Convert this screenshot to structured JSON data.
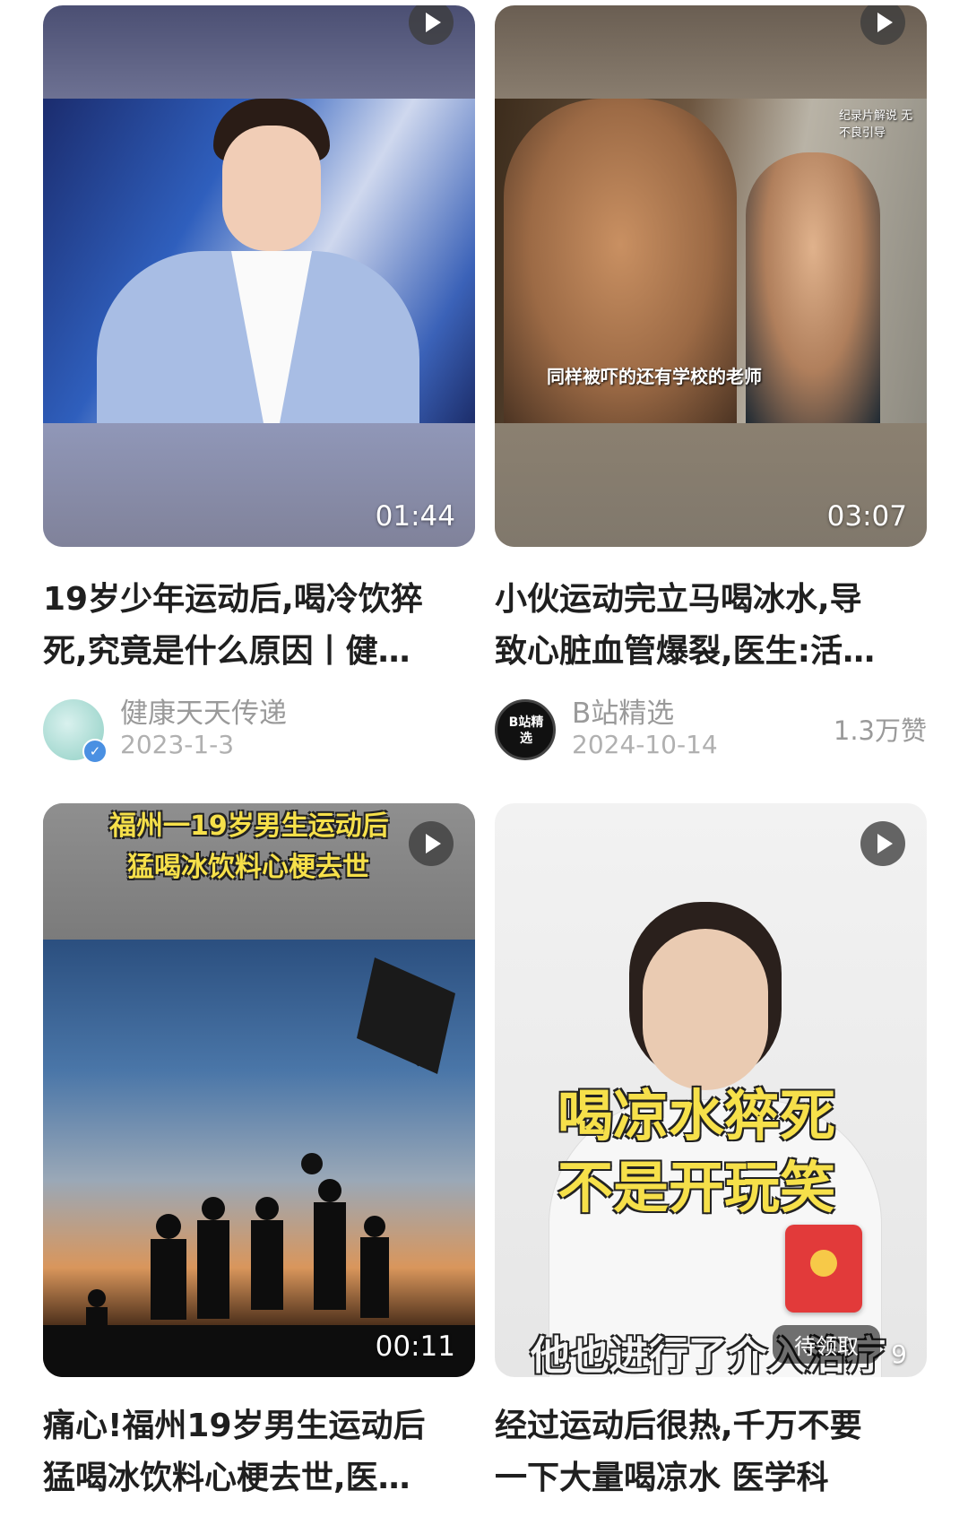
{
  "cards": [
    {
      "duration": "01:44",
      "title_line1": "19岁少年运动后,喝冷饮猝",
      "title_line2": "死,究竟是什么原因丨健…",
      "author": "健康天天传递",
      "date": "2023-1-3",
      "likes": ""
    },
    {
      "duration": "03:07",
      "subtitle": "同样被吓的还有学校的老师",
      "watermark": "纪录片解说 无不良引导",
      "title_line1": "小伙运动完立马喝冰水,导",
      "title_line2": "致心脏血管爆裂,医生:活…",
      "author": "B站精选",
      "avatar_text": "B站精选",
      "date": "2024-10-14",
      "likes": "1.3万赞"
    },
    {
      "duration": "00:11",
      "caption_line1": "福州一19岁男生运动后",
      "caption_line2": "猛喝冰饮料心梗去世",
      "title_line1": "痛心!福州19岁男生运动后",
      "title_line2": "猛喝冰饮料心梗去世,医…"
    },
    {
      "caption_line1": "喝凉水猝死",
      "caption_line2": "不是开玩笑",
      "bottom_caption": "他也进行了介入治疗",
      "red_packet_label": "待领取",
      "corner_number": "9",
      "title_line1": "经过运动后很热,千万不要",
      "title_line2": "一下大量喝凉水 医学科"
    }
  ],
  "colors": {
    "title": "#1f1f1f",
    "meta": "#9a9a9a",
    "caption_yellow": "#f6e04a",
    "red_packet": "#e23a3a"
  },
  "icons": [
    "play-icon",
    "verified-icon",
    "red-packet-icon"
  ]
}
